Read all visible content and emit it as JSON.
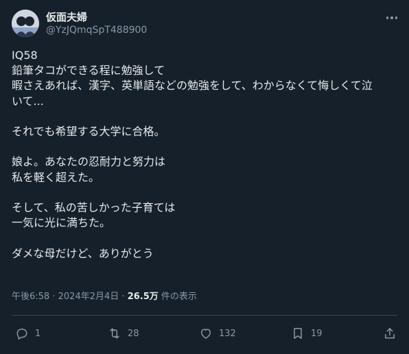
{
  "user": {
    "display_name": "仮面夫婦",
    "handle": "@YzJQmqSpT488900"
  },
  "post": {
    "lines": [
      "IQ58",
      "鉛筆タコができる程に勉強して",
      "暇さえあれば、漢字、英単語などの勉強をして、わからなくて悔しくて泣",
      "いて...",
      "",
      "それでも希望する大学に合格。",
      "",
      "娘よ。あなたの忍耐力と努力は",
      "私を軽く超えた。",
      "",
      "そして、私の苦しかった子育ては",
      "一気に光に満ちた。",
      "",
      "ダメな母だけど、ありがとう"
    ]
  },
  "meta": {
    "time": "午後6:58",
    "separator": "·",
    "date": "2024年2月4日",
    "views_count": "26.5万",
    "views_label": "件の表示"
  },
  "actions": {
    "reply_count": "1",
    "repost_count": "28",
    "like_count": "132",
    "bookmark_count": "19"
  },
  "icons": {
    "more": "more-icon",
    "reply": "reply-icon",
    "repost": "repost-icon",
    "like": "like-icon",
    "bookmark": "bookmark-icon",
    "share": "share-icon"
  },
  "colors": {
    "background": "#15202b",
    "text_primary": "#e7e9ea",
    "text_secondary": "#8b98a5",
    "divider": "#38444d"
  }
}
